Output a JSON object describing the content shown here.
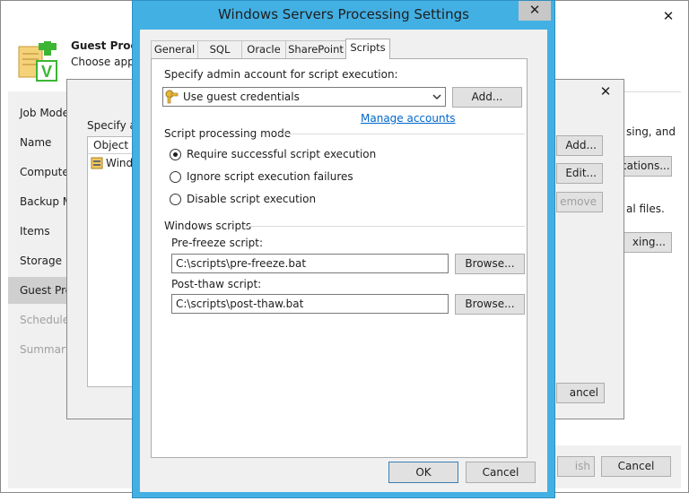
{
  "back_window": {
    "header_title": "Guest Proces",
    "header_subtitle": "Choose appli",
    "nav": [
      "Job Mode",
      "Name",
      "Computer",
      "Backup M",
      "Items",
      "Storage",
      "Guest Pro",
      "Schedule",
      "Summary"
    ],
    "right_texts": [
      "sing, and",
      "al files."
    ],
    "applications_button": "cations...",
    "indexing_button": "xing...",
    "finish_button": "ish",
    "cancel_button": "Cancel"
  },
  "mid_window": {
    "label": "Specify ap",
    "column_object": "Object",
    "row_1": "Wind",
    "add_button": "Add...",
    "edit_button": "Edit...",
    "remove_button": "emove",
    "cancel_button": "ancel"
  },
  "dialog": {
    "title": "Windows Servers Processing Settings",
    "tabs": [
      "General",
      "SQL",
      "Oracle",
      "SharePoint",
      "Scripts"
    ],
    "admin_label": "Specify admin account for script execution:",
    "credentials_value": "Use guest credentials",
    "add_button": "Add...",
    "manage_accounts": "Manage accounts",
    "mode_label": "Script processing mode",
    "mode_options": [
      "Require successful script execution",
      "Ignore script execution failures",
      "Disable script execution"
    ],
    "scripts_label": "Windows scripts",
    "prefreeze_label": "Pre-freeze script:",
    "prefreeze_value": "C:\\scripts\\pre-freeze.bat",
    "postthaw_label": "Post-thaw script:",
    "postthaw_value": "C:\\scripts\\post-thaw.bat",
    "browse_button": "Browse...",
    "ok_button": "OK",
    "cancel_button": "Cancel"
  },
  "colors": {
    "dialog_border": "#43b0e4",
    "link": "#0066cc"
  }
}
